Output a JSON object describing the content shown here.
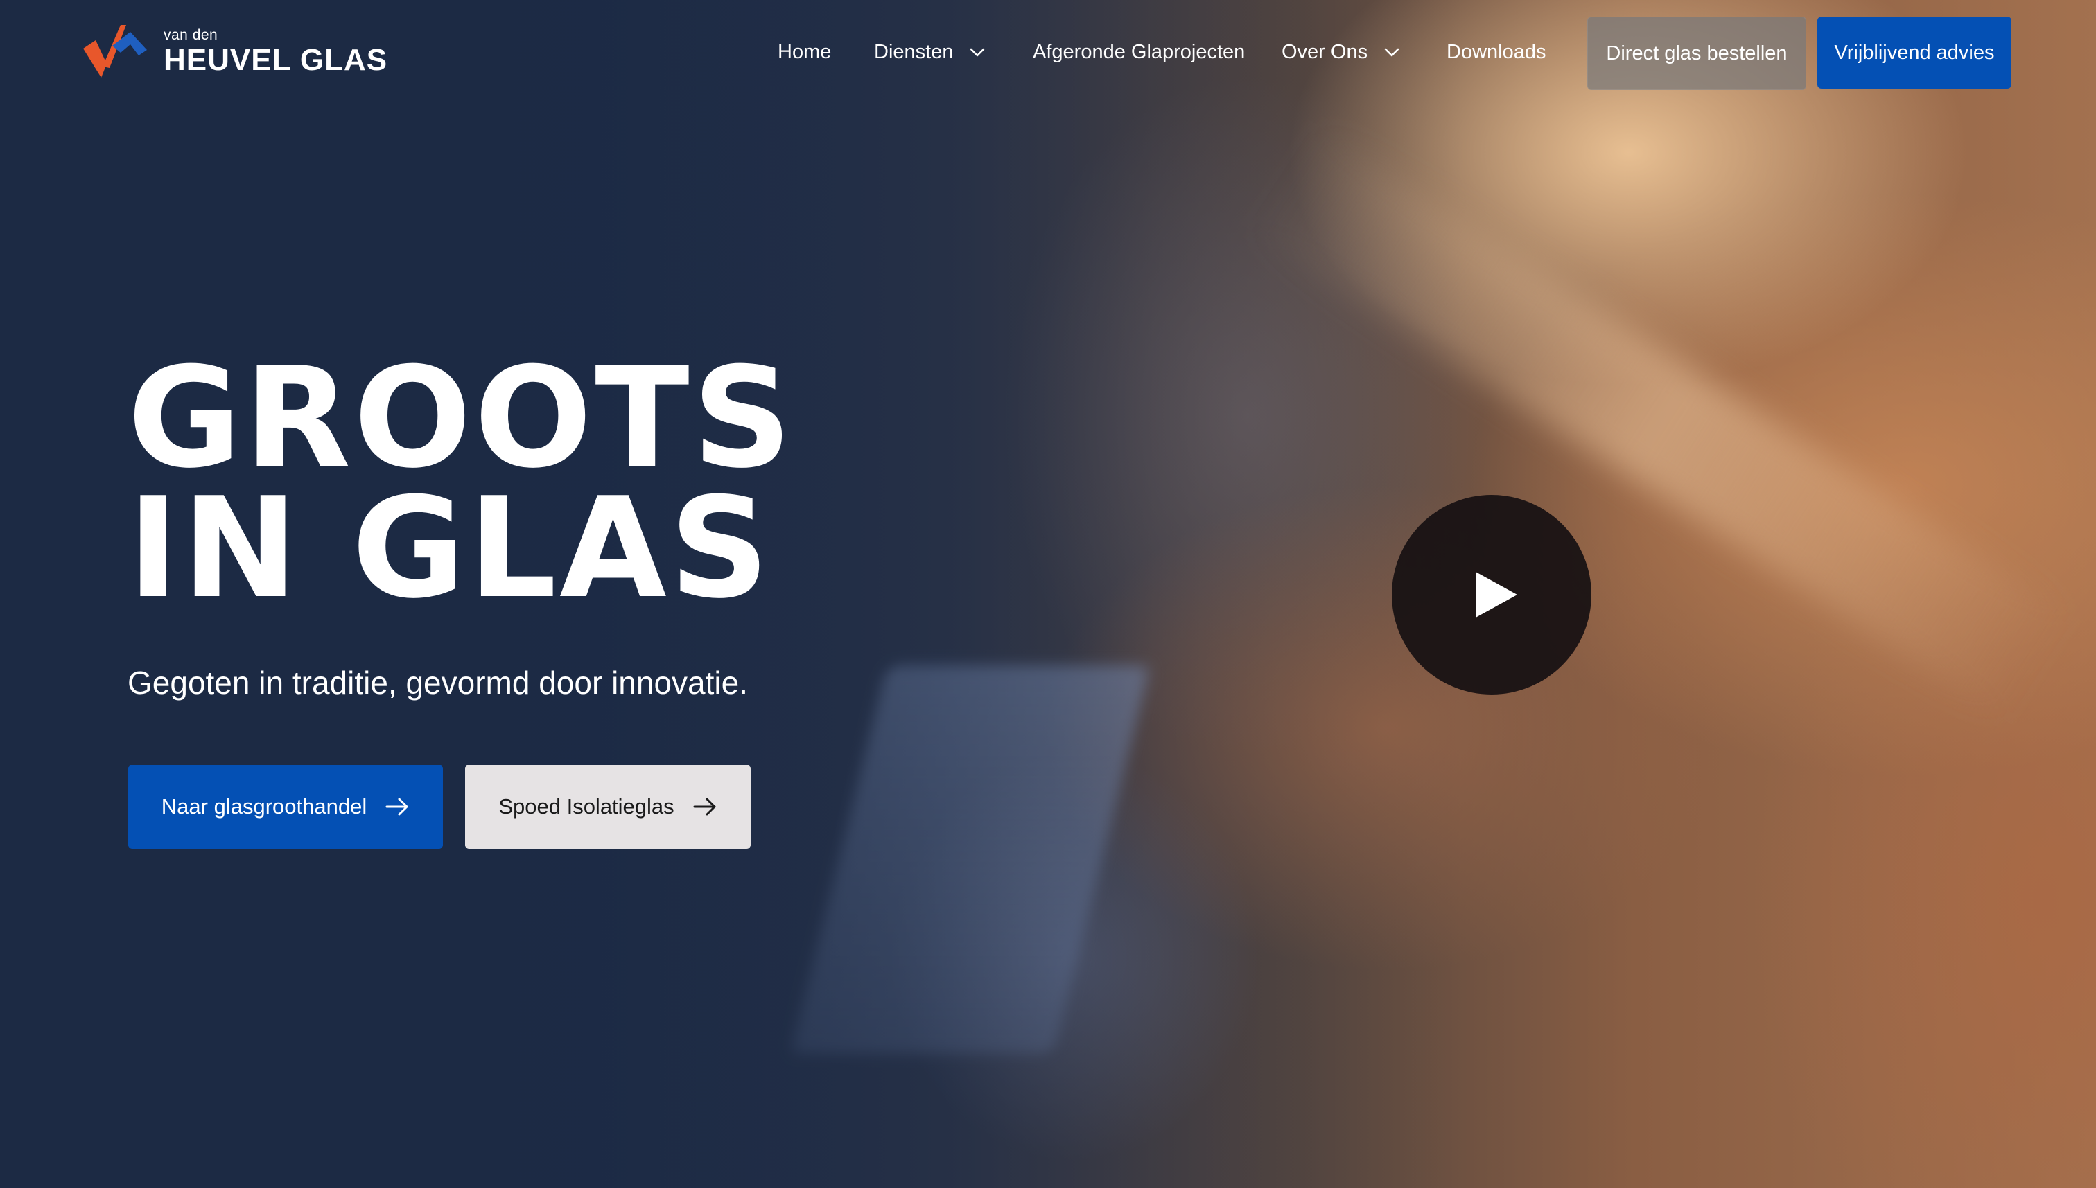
{
  "brand": {
    "small": "van den",
    "name": "HEUVEL GLAS",
    "colors": {
      "orange": "#e8572b",
      "blue": "#1f5fc0"
    }
  },
  "nav": {
    "items": [
      {
        "label": "Home",
        "dropdown": false
      },
      {
        "label": "Diensten",
        "dropdown": true
      },
      {
        "label": "Afgeronde Glaprojecten",
        "dropdown": false
      },
      {
        "label": "Over Ons",
        "dropdown": true
      },
      {
        "label": "Downloads",
        "dropdown": false
      }
    ],
    "order_button": "Direct glas bestellen",
    "advice_button": "Vrijblijvend advies"
  },
  "hero": {
    "title_line1": "GROOTS",
    "title_line2": "IN GLAS",
    "subtitle": "Gegoten in traditie, gevormd door innovatie.",
    "cta_primary": "Naar glasgroothandel",
    "cta_secondary": "Spoed Isolatieglas",
    "play_icon": "play-icon"
  },
  "colors": {
    "primary_blue": "#0450b4",
    "navy": "#1c2a44",
    "light_button": "#e6e3e4"
  }
}
